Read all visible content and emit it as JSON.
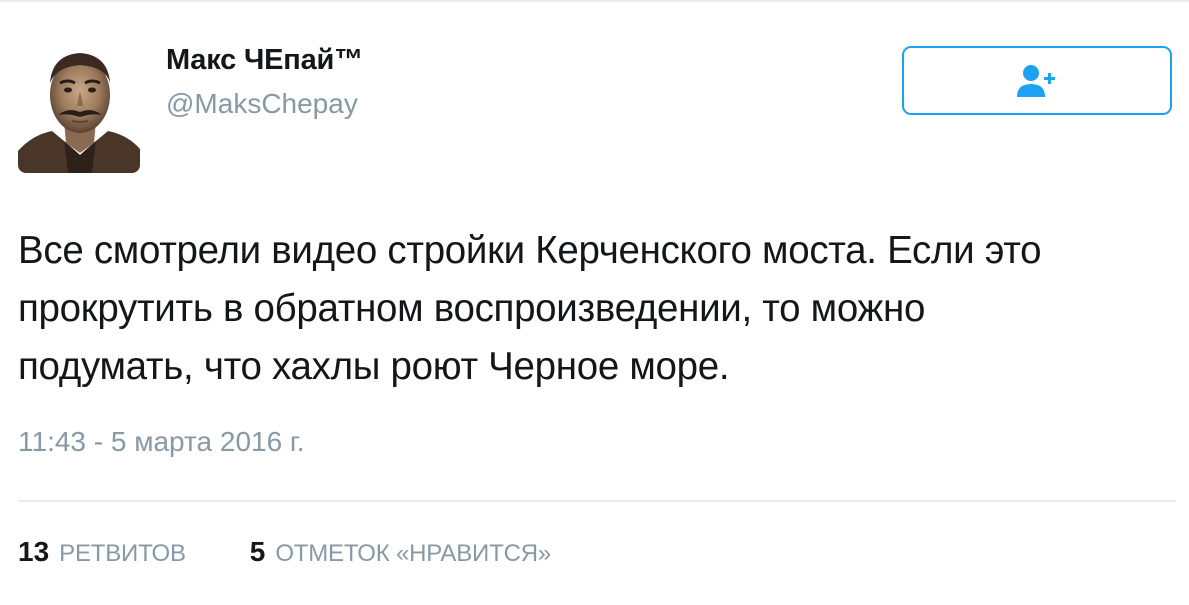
{
  "user": {
    "display_name": "Макс ЧЕпай™",
    "screen_name": "@MaksChepay"
  },
  "follow_button": {
    "icon": "follow-user-plus-icon",
    "color": "#1da1f2"
  },
  "tweet": {
    "lines": [
      "Все смотрели видео стройки Керченского моста. Если это",
      "прокрутить в обратном воспроизведении, то можно",
      "подумать, что хахлы роют Черное море."
    ],
    "timestamp": "11:43 - 5 марта 2016 г."
  },
  "stats": {
    "retweets_count": "13",
    "retweets_label": "РЕТВИТОВ",
    "likes_count": "5",
    "likes_label": "ОТМЕТОК «НРАВИТСЯ»"
  },
  "colors": {
    "text": "#14171a",
    "secondary": "#8899a6",
    "accent": "#1da1f2",
    "divider": "#e6ecf0"
  }
}
